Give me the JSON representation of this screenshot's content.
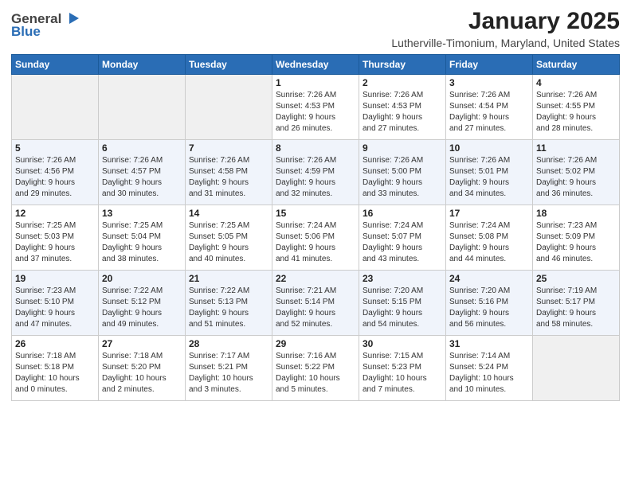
{
  "logo": {
    "general": "General",
    "blue": "Blue"
  },
  "title": "January 2025",
  "location": "Lutherville-Timonium, Maryland, United States",
  "weekdays": [
    "Sunday",
    "Monday",
    "Tuesday",
    "Wednesday",
    "Thursday",
    "Friday",
    "Saturday"
  ],
  "weeks": [
    [
      {
        "day": "",
        "info": ""
      },
      {
        "day": "",
        "info": ""
      },
      {
        "day": "",
        "info": ""
      },
      {
        "day": "1",
        "info": "Sunrise: 7:26 AM\nSunset: 4:53 PM\nDaylight: 9 hours\nand 26 minutes."
      },
      {
        "day": "2",
        "info": "Sunrise: 7:26 AM\nSunset: 4:53 PM\nDaylight: 9 hours\nand 27 minutes."
      },
      {
        "day": "3",
        "info": "Sunrise: 7:26 AM\nSunset: 4:54 PM\nDaylight: 9 hours\nand 27 minutes."
      },
      {
        "day": "4",
        "info": "Sunrise: 7:26 AM\nSunset: 4:55 PM\nDaylight: 9 hours\nand 28 minutes."
      }
    ],
    [
      {
        "day": "5",
        "info": "Sunrise: 7:26 AM\nSunset: 4:56 PM\nDaylight: 9 hours\nand 29 minutes."
      },
      {
        "day": "6",
        "info": "Sunrise: 7:26 AM\nSunset: 4:57 PM\nDaylight: 9 hours\nand 30 minutes."
      },
      {
        "day": "7",
        "info": "Sunrise: 7:26 AM\nSunset: 4:58 PM\nDaylight: 9 hours\nand 31 minutes."
      },
      {
        "day": "8",
        "info": "Sunrise: 7:26 AM\nSunset: 4:59 PM\nDaylight: 9 hours\nand 32 minutes."
      },
      {
        "day": "9",
        "info": "Sunrise: 7:26 AM\nSunset: 5:00 PM\nDaylight: 9 hours\nand 33 minutes."
      },
      {
        "day": "10",
        "info": "Sunrise: 7:26 AM\nSunset: 5:01 PM\nDaylight: 9 hours\nand 34 minutes."
      },
      {
        "day": "11",
        "info": "Sunrise: 7:26 AM\nSunset: 5:02 PM\nDaylight: 9 hours\nand 36 minutes."
      }
    ],
    [
      {
        "day": "12",
        "info": "Sunrise: 7:25 AM\nSunset: 5:03 PM\nDaylight: 9 hours\nand 37 minutes."
      },
      {
        "day": "13",
        "info": "Sunrise: 7:25 AM\nSunset: 5:04 PM\nDaylight: 9 hours\nand 38 minutes."
      },
      {
        "day": "14",
        "info": "Sunrise: 7:25 AM\nSunset: 5:05 PM\nDaylight: 9 hours\nand 40 minutes."
      },
      {
        "day": "15",
        "info": "Sunrise: 7:24 AM\nSunset: 5:06 PM\nDaylight: 9 hours\nand 41 minutes."
      },
      {
        "day": "16",
        "info": "Sunrise: 7:24 AM\nSunset: 5:07 PM\nDaylight: 9 hours\nand 43 minutes."
      },
      {
        "day": "17",
        "info": "Sunrise: 7:24 AM\nSunset: 5:08 PM\nDaylight: 9 hours\nand 44 minutes."
      },
      {
        "day": "18",
        "info": "Sunrise: 7:23 AM\nSunset: 5:09 PM\nDaylight: 9 hours\nand 46 minutes."
      }
    ],
    [
      {
        "day": "19",
        "info": "Sunrise: 7:23 AM\nSunset: 5:10 PM\nDaylight: 9 hours\nand 47 minutes."
      },
      {
        "day": "20",
        "info": "Sunrise: 7:22 AM\nSunset: 5:12 PM\nDaylight: 9 hours\nand 49 minutes."
      },
      {
        "day": "21",
        "info": "Sunrise: 7:22 AM\nSunset: 5:13 PM\nDaylight: 9 hours\nand 51 minutes."
      },
      {
        "day": "22",
        "info": "Sunrise: 7:21 AM\nSunset: 5:14 PM\nDaylight: 9 hours\nand 52 minutes."
      },
      {
        "day": "23",
        "info": "Sunrise: 7:20 AM\nSunset: 5:15 PM\nDaylight: 9 hours\nand 54 minutes."
      },
      {
        "day": "24",
        "info": "Sunrise: 7:20 AM\nSunset: 5:16 PM\nDaylight: 9 hours\nand 56 minutes."
      },
      {
        "day": "25",
        "info": "Sunrise: 7:19 AM\nSunset: 5:17 PM\nDaylight: 9 hours\nand 58 minutes."
      }
    ],
    [
      {
        "day": "26",
        "info": "Sunrise: 7:18 AM\nSunset: 5:18 PM\nDaylight: 10 hours\nand 0 minutes."
      },
      {
        "day": "27",
        "info": "Sunrise: 7:18 AM\nSunset: 5:20 PM\nDaylight: 10 hours\nand 2 minutes."
      },
      {
        "day": "28",
        "info": "Sunrise: 7:17 AM\nSunset: 5:21 PM\nDaylight: 10 hours\nand 3 minutes."
      },
      {
        "day": "29",
        "info": "Sunrise: 7:16 AM\nSunset: 5:22 PM\nDaylight: 10 hours\nand 5 minutes."
      },
      {
        "day": "30",
        "info": "Sunrise: 7:15 AM\nSunset: 5:23 PM\nDaylight: 10 hours\nand 7 minutes."
      },
      {
        "day": "31",
        "info": "Sunrise: 7:14 AM\nSunset: 5:24 PM\nDaylight: 10 hours\nand 10 minutes."
      },
      {
        "day": "",
        "info": ""
      }
    ]
  ]
}
